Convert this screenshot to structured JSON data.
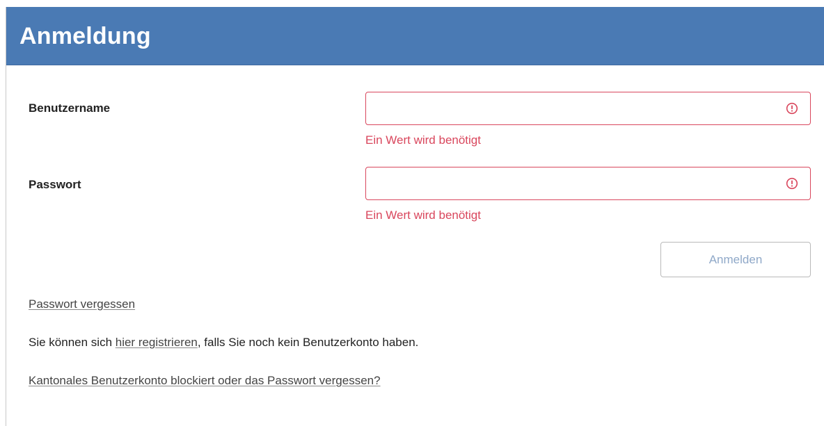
{
  "header": {
    "title": "Anmeldung",
    "background": "#4a7ab4"
  },
  "form": {
    "username": {
      "label": "Benutzername",
      "value": "",
      "error": "Ein Wert wird benötigt"
    },
    "password": {
      "label": "Passwort",
      "value": "",
      "error": "Ein Wert wird benötigt"
    },
    "submit_label": "Anmelden",
    "error_color": "#d9465c"
  },
  "links": {
    "forgot_password": "Passwort vergessen",
    "register_prefix": "Sie können sich ",
    "register_link": "hier registrieren",
    "register_suffix": ", falls Sie noch kein Benutzerkonto haben.",
    "cantonal_account": "Kantonales Benutzerkonto blockiert oder das Passwort vergessen?"
  },
  "icons": {
    "field_error": "exclamation-circle-icon"
  }
}
